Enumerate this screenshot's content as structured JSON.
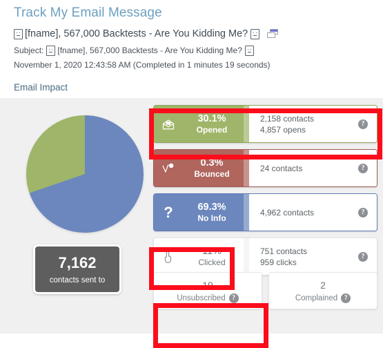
{
  "header": {
    "page_title": "Track My Email Message",
    "message_name_prefix_icon": "emoji-placeholder-icon",
    "message_name": "[fname], 567,000 Backtests - Are You Kidding Me?",
    "message_name_suffix_icon": "emoji-placeholder-icon",
    "copy_icon": "copy-windows-icon",
    "subject_prefix": "Subject:",
    "subject_text": "[fname], 567,000 Backtests - Are You Kidding Me?",
    "sent_datetime": "November 1, 2020 12:43:58 AM (Completed in 1 minutes 19 seconds)"
  },
  "section": {
    "title": "Email Impact"
  },
  "sent_box": {
    "value": "7,162",
    "label": "contacts sent to"
  },
  "help_glyph": "?",
  "cards": [
    {
      "key": "opened",
      "icon": "open-envelope-icon",
      "percent": "30.1%",
      "name": "Opened",
      "detail_line1": "2,158 contacts",
      "detail_line2": "4,857 opens",
      "color": "#9fb569"
    },
    {
      "key": "bounced",
      "icon": "bounce-ball-icon",
      "percent": "0.3%",
      "name": "Bounced",
      "detail_line1": "24 contacts",
      "detail_line2": "",
      "color": "#b0655d"
    },
    {
      "key": "noinfo",
      "icon": "question-mark-icon",
      "percent": "69.3%",
      "name": "No Info",
      "detail_line1": "4,962 contacts",
      "detail_line2": "",
      "color": "#6b87bd"
    },
    {
      "key": "clicked",
      "icon": "pointing-hand-icon",
      "percent": "11%",
      "name": "Clicked",
      "detail_line1": "751 contacts",
      "detail_line2": "959 clicks",
      "color": "#ffffff"
    }
  ],
  "bottom_cards": [
    {
      "key": "unsubscribed",
      "value": "19",
      "label": "Unsubscribed"
    },
    {
      "key": "complained",
      "value": "2",
      "label": "Complained"
    }
  ],
  "chart_data": {
    "type": "pie",
    "title": "Email Impact",
    "labels": [
      "No Info",
      "Opened"
    ],
    "values": [
      69.3,
      30.1
    ],
    "colors": [
      "#6b87bd",
      "#9fb569"
    ],
    "unit": "%",
    "legend": "none",
    "start_angle_deg": 0,
    "direction": "counterclockwise"
  },
  "annotations": [
    {
      "name": "redbox-opened",
      "target": "opened-card",
      "color": "#fb0d1b"
    },
    {
      "name": "redbox-clicked",
      "target": "clicked-card-left",
      "color": "#fb0d1b"
    },
    {
      "name": "redbox-unsub",
      "target": "unsubscribed-card",
      "color": "#fb0d1b"
    }
  ]
}
